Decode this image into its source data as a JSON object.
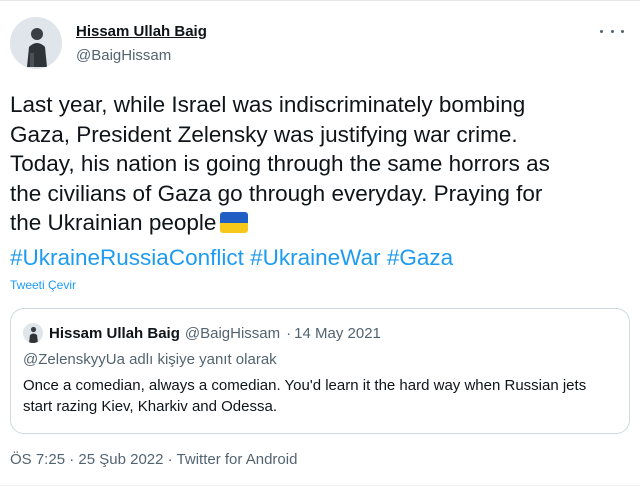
{
  "author": {
    "display_name": "Hissam Ullah Baig",
    "handle": "@BaigHissam"
  },
  "tweet": {
    "text": "Last year, while Israel was indiscriminately bombing\nGaza, President Zelensky was justifying war crime.\nToday, his nation is  going through the same horrors as\nthe civilians of Gaza go through everyday. Praying for\nthe Ukrainian people",
    "flag_emoji": "ukraine-flag",
    "hashtags": [
      "#UkraineRussiaConflict",
      "#UkraineWar",
      "#Gaza"
    ],
    "translate_label": "Tweeti Çevir"
  },
  "quoted_tweet": {
    "display_name": "Hissam Ullah Baig",
    "handle": "@BaigHissam",
    "separator": "·",
    "date": "14 May 2021",
    "reply_context": "@ZelenskyyUa adlı kişiye yanıt olarak",
    "text": "Once a comedian, always a comedian. You'd learn it the hard way when Russian jets start razing Kiev, Kharkiv and Odessa."
  },
  "meta": {
    "time": "ÖS 7:25",
    "separator": "·",
    "date": "25 Şub 2022",
    "source": "Twitter for Android"
  },
  "icons": {
    "more": "more-options-icon"
  },
  "colors": {
    "link": "#1d9bf0",
    "secondary_text": "#536471",
    "primary_text": "#0f1419",
    "border": "#cfd9de",
    "flag_blue": "#1f5fc4",
    "flag_yellow": "#f7c71a"
  }
}
